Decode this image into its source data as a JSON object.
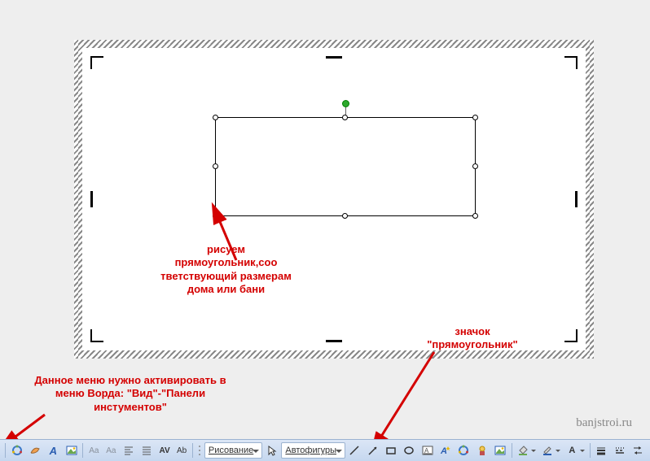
{
  "annotations": {
    "shape_label": "рисуем прямоугольник,соо тветствующий размерам дома или бани",
    "menu_label": "Данное меню нужно активировать в меню Ворда: \"Вид\"-\"Панели инстументов\"",
    "icon_label": "значок \"прямоугольник\""
  },
  "watermark": "banjstroi.ru",
  "toolbar": {
    "draw_label": "Рисование",
    "autoshapes_label": "Автофигуры",
    "buttons": {
      "wordart": "A",
      "text_effects1": "Aa",
      "text_effects2": "Aa",
      "align_left": "≡",
      "align_just": "≡",
      "av": "AV",
      "ab": "Ab",
      "font_color_letter": "A"
    }
  }
}
